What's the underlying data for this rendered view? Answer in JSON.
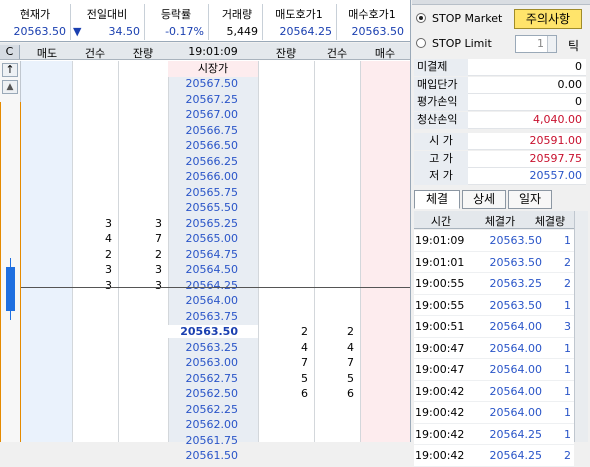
{
  "summary": {
    "headers": [
      "현재가",
      "전일대비",
      "등락률",
      "거래량",
      "매도호가1",
      "매수호가1"
    ],
    "current_price": "20563.50",
    "change_arrow": "▼",
    "change": "34.50",
    "change_rate": "-0.17%",
    "volume": "5,449",
    "ask1": "20564.25",
    "bid1": "20563.50"
  },
  "book": {
    "side_button": "C",
    "scroll_up": "↑",
    "scroll_top": "▲",
    "headers": {
      "ask": "매도",
      "ask_cnt": "건수",
      "ask_rem": "잔량",
      "time": "19:01:09",
      "bid_rem": "잔량",
      "bid_cnt": "건수",
      "bid": "매수"
    },
    "market_label": "시장가",
    "rows": [
      {
        "price": "20567.50",
        "ask_cnt": "",
        "ask_rem": "",
        "bid_rem": "",
        "bid_cnt": ""
      },
      {
        "price": "20567.25",
        "ask_cnt": "",
        "ask_rem": "",
        "bid_rem": "",
        "bid_cnt": ""
      },
      {
        "price": "20567.00",
        "ask_cnt": "",
        "ask_rem": "",
        "bid_rem": "",
        "bid_cnt": ""
      },
      {
        "price": "20566.75",
        "ask_cnt": "",
        "ask_rem": "",
        "bid_rem": "",
        "bid_cnt": ""
      },
      {
        "price": "20566.50",
        "ask_cnt": "",
        "ask_rem": "",
        "bid_rem": "",
        "bid_cnt": ""
      },
      {
        "price": "20566.25",
        "ask_cnt": "",
        "ask_rem": "",
        "bid_rem": "",
        "bid_cnt": ""
      },
      {
        "price": "20566.00",
        "ask_cnt": "",
        "ask_rem": "",
        "bid_rem": "",
        "bid_cnt": ""
      },
      {
        "price": "20565.75",
        "ask_cnt": "",
        "ask_rem": "",
        "bid_rem": "",
        "bid_cnt": ""
      },
      {
        "price": "20565.50",
        "ask_cnt": "",
        "ask_rem": "",
        "bid_rem": "",
        "bid_cnt": ""
      },
      {
        "price": "20565.25",
        "ask_cnt": "3",
        "ask_rem": "3",
        "bid_rem": "",
        "bid_cnt": ""
      },
      {
        "price": "20565.00",
        "ask_cnt": "4",
        "ask_rem": "7",
        "bid_rem": "",
        "bid_cnt": ""
      },
      {
        "price": "20564.75",
        "ask_cnt": "2",
        "ask_rem": "2",
        "bid_rem": "",
        "bid_cnt": ""
      },
      {
        "price": "20564.50",
        "ask_cnt": "3",
        "ask_rem": "3",
        "bid_rem": "",
        "bid_cnt": ""
      },
      {
        "price": "20564.25",
        "ask_cnt": "3",
        "ask_rem": "3",
        "bid_rem": "",
        "bid_cnt": ""
      },
      {
        "price": "20564.00",
        "ask_cnt": "",
        "ask_rem": "",
        "bid_rem": "",
        "bid_cnt": ""
      },
      {
        "price": "20563.75",
        "ask_cnt": "",
        "ask_rem": "",
        "bid_rem": "",
        "bid_cnt": ""
      },
      {
        "price": "20563.50",
        "ask_cnt": "",
        "ask_rem": "",
        "bid_rem": "2",
        "bid_cnt": "2",
        "current": true
      },
      {
        "price": "20563.25",
        "ask_cnt": "",
        "ask_rem": "",
        "bid_rem": "4",
        "bid_cnt": "4"
      },
      {
        "price": "20563.00",
        "ask_cnt": "",
        "ask_rem": "",
        "bid_rem": "7",
        "bid_cnt": "7"
      },
      {
        "price": "20562.75",
        "ask_cnt": "",
        "ask_rem": "",
        "bid_rem": "5",
        "bid_cnt": "5"
      },
      {
        "price": "20562.50",
        "ask_cnt": "",
        "ask_rem": "",
        "bid_rem": "6",
        "bid_cnt": "6"
      },
      {
        "price": "20562.25",
        "ask_cnt": "",
        "ask_rem": "",
        "bid_rem": "",
        "bid_cnt": ""
      },
      {
        "price": "20562.00",
        "ask_cnt": "",
        "ask_rem": "",
        "bid_rem": "",
        "bid_cnt": ""
      },
      {
        "price": "20561.75",
        "ask_cnt": "",
        "ask_rem": "",
        "bid_rem": "",
        "bid_cnt": ""
      },
      {
        "price": "20561.50",
        "ask_cnt": "",
        "ask_rem": "",
        "bid_rem": "",
        "bid_cnt": ""
      }
    ]
  },
  "right": {
    "stop_market": "STOP Market",
    "stop_limit": "STOP Limit",
    "caution_button": "주의사항",
    "tick_value": "1",
    "tick_label": "틱",
    "account": [
      {
        "label": "미결제",
        "value": "0",
        "color": "#000000"
      },
      {
        "label": "매입단가",
        "value": "0.00",
        "color": "#000000"
      },
      {
        "label": "평가손익",
        "value": "0",
        "color": "#000000"
      },
      {
        "label": "청산손익",
        "value": "4,040.00",
        "color": "#c8102e"
      }
    ],
    "prices": [
      {
        "label": "시 가",
        "value": "20591.00",
        "color": "#c8102e"
      },
      {
        "label": "고 가",
        "value": "20597.75",
        "color": "#c8102e"
      },
      {
        "label": "저 가",
        "value": "20557.00",
        "color": "#2a55c8"
      }
    ],
    "tabs": [
      "체결",
      "상세",
      "일자"
    ],
    "fills_headers": [
      "시간",
      "체결가",
      "체결량"
    ],
    "fills": [
      {
        "time": "19:01:09",
        "price": "20563.50",
        "qty": "1"
      },
      {
        "time": "19:01:01",
        "price": "20563.50",
        "qty": "2"
      },
      {
        "time": "19:00:55",
        "price": "20563.25",
        "qty": "2"
      },
      {
        "time": "19:00:55",
        "price": "20563.50",
        "qty": "1"
      },
      {
        "time": "19:00:51",
        "price": "20564.00",
        "qty": "3"
      },
      {
        "time": "19:00:47",
        "price": "20564.00",
        "qty": "1"
      },
      {
        "time": "19:00:47",
        "price": "20564.00",
        "qty": "1"
      },
      {
        "time": "19:00:42",
        "price": "20564.00",
        "qty": "1"
      },
      {
        "time": "19:00:42",
        "price": "20564.00",
        "qty": "1"
      },
      {
        "time": "19:00:42",
        "price": "20564.25",
        "qty": "1"
      },
      {
        "time": "19:00:42",
        "price": "20564.25",
        "qty": "2"
      }
    ]
  }
}
